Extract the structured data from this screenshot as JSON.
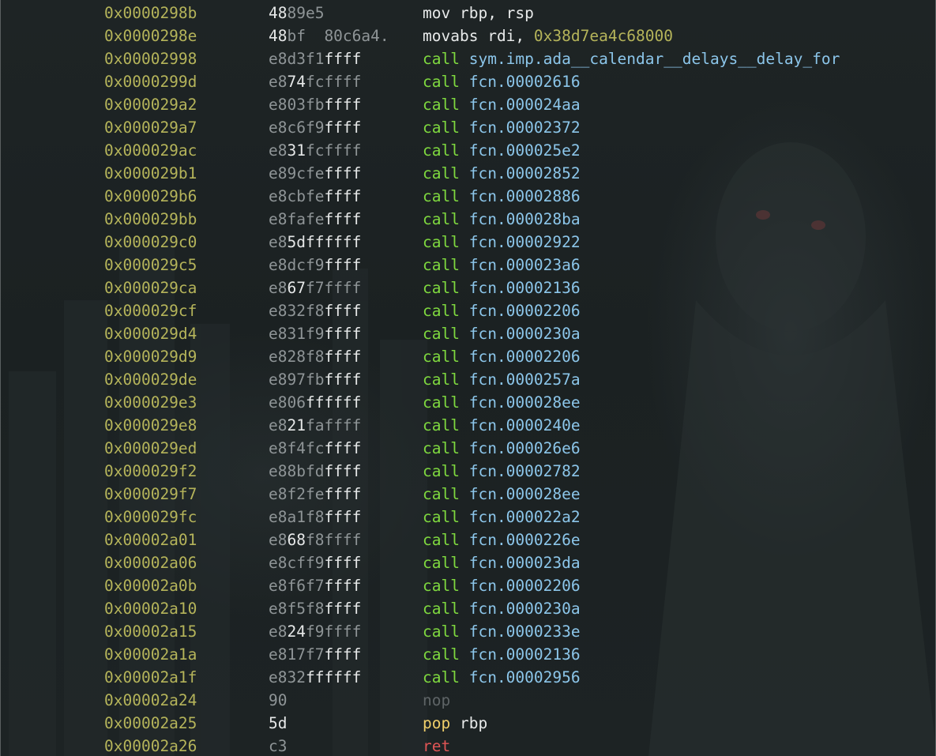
{
  "disassembly": {
    "rows": [
      {
        "address": "0x0000298b",
        "bytes_dim": "",
        "bytes_bright": "48",
        "bytes_tail": "89e5",
        "mnemonic": "mov",
        "mnemonic_class": "plain",
        "operand": "rbp, rsp",
        "operand_class": "plain"
      },
      {
        "address": "0x0000298e",
        "bytes_dim": "",
        "bytes_bright": "48",
        "bytes_tail": "bf  80c6a4.",
        "mnemonic": "movabs",
        "mnemonic_class": "plain",
        "operand": "rdi, ",
        "operand_class": "plain",
        "operand_imm": "0x38d7ea4c68000"
      },
      {
        "address": "0x00002998",
        "bytes_dim": "e8d3f1",
        "bytes_bright": "ffff",
        "bytes_tail": "",
        "mnemonic": "call",
        "mnemonic_class": "call",
        "operand": "sym.imp.ada__calendar__delays__delay_for",
        "operand_class": "target"
      },
      {
        "address": "0x0000299d",
        "bytes_dim": "e8",
        "bytes_bright": "74",
        "bytes_tail": "fcffff",
        "mnemonic": "call",
        "mnemonic_class": "call",
        "operand": "fcn.00002616",
        "operand_class": "target"
      },
      {
        "address": "0x000029a2",
        "bytes_dim": "e803fb",
        "bytes_bright": "ffff",
        "bytes_tail": "",
        "mnemonic": "call",
        "mnemonic_class": "call",
        "operand": "fcn.000024aa",
        "operand_class": "target"
      },
      {
        "address": "0x000029a7",
        "bytes_dim": "e8c6f9",
        "bytes_bright": "ffff",
        "bytes_tail": "",
        "mnemonic": "call",
        "mnemonic_class": "call",
        "operand": "fcn.00002372",
        "operand_class": "target"
      },
      {
        "address": "0x000029ac",
        "bytes_dim": "e8",
        "bytes_bright": "31",
        "bytes_tail": "fcffff",
        "mnemonic": "call",
        "mnemonic_class": "call",
        "operand": "fcn.000025e2",
        "operand_class": "target"
      },
      {
        "address": "0x000029b1",
        "bytes_dim": "e89cfe",
        "bytes_bright": "ffff",
        "bytes_tail": "",
        "mnemonic": "call",
        "mnemonic_class": "call",
        "operand": "fcn.00002852",
        "operand_class": "target"
      },
      {
        "address": "0x000029b6",
        "bytes_dim": "e8cbfe",
        "bytes_bright": "ffff",
        "bytes_tail": "",
        "mnemonic": "call",
        "mnemonic_class": "call",
        "operand": "fcn.00002886",
        "operand_class": "target"
      },
      {
        "address": "0x000029bb",
        "bytes_dim": "e8fafe",
        "bytes_bright": "ffff",
        "bytes_tail": "",
        "mnemonic": "call",
        "mnemonic_class": "call",
        "operand": "fcn.000028ba",
        "operand_class": "target"
      },
      {
        "address": "0x000029c0",
        "bytes_dim": "e8",
        "bytes_bright": "5dffffff",
        "bytes_tail": "",
        "mnemonic": "call",
        "mnemonic_class": "call",
        "operand": "fcn.00002922",
        "operand_class": "target"
      },
      {
        "address": "0x000029c5",
        "bytes_dim": "e8dcf9",
        "bytes_bright": "ffff",
        "bytes_tail": "",
        "mnemonic": "call",
        "mnemonic_class": "call",
        "operand": "fcn.000023a6",
        "operand_class": "target"
      },
      {
        "address": "0x000029ca",
        "bytes_dim": "e8",
        "bytes_bright": "67",
        "bytes_tail": "f7ffff",
        "mnemonic": "call",
        "mnemonic_class": "call",
        "operand": "fcn.00002136",
        "operand_class": "target"
      },
      {
        "address": "0x000029cf",
        "bytes_dim": "e832f8",
        "bytes_bright": "ffff",
        "bytes_tail": "",
        "mnemonic": "call",
        "mnemonic_class": "call",
        "operand": "fcn.00002206",
        "operand_class": "target"
      },
      {
        "address": "0x000029d4",
        "bytes_dim": "e831f9",
        "bytes_bright": "ffff",
        "bytes_tail": "",
        "mnemonic": "call",
        "mnemonic_class": "call",
        "operand": "fcn.0000230a",
        "operand_class": "target"
      },
      {
        "address": "0x000029d9",
        "bytes_dim": "e828f8",
        "bytes_bright": "ffff",
        "bytes_tail": "",
        "mnemonic": "call",
        "mnemonic_class": "call",
        "operand": "fcn.00002206",
        "operand_class": "target"
      },
      {
        "address": "0x000029de",
        "bytes_dim": "e897fb",
        "bytes_bright": "ffff",
        "bytes_tail": "",
        "mnemonic": "call",
        "mnemonic_class": "call",
        "operand": "fcn.0000257a",
        "operand_class": "target"
      },
      {
        "address": "0x000029e3",
        "bytes_dim": "e806",
        "bytes_bright": "ffffff",
        "bytes_tail": "",
        "mnemonic": "call",
        "mnemonic_class": "call",
        "operand": "fcn.000028ee",
        "operand_class": "target"
      },
      {
        "address": "0x000029e8",
        "bytes_dim": "e8",
        "bytes_bright": "21",
        "bytes_tail": "faffff",
        "mnemonic": "call",
        "mnemonic_class": "call",
        "operand": "fcn.0000240e",
        "operand_class": "target"
      },
      {
        "address": "0x000029ed",
        "bytes_dim": "e8f4fc",
        "bytes_bright": "ffff",
        "bytes_tail": "",
        "mnemonic": "call",
        "mnemonic_class": "call",
        "operand": "fcn.000026e6",
        "operand_class": "target"
      },
      {
        "address": "0x000029f2",
        "bytes_dim": "e88bfd",
        "bytes_bright": "ffff",
        "bytes_tail": "",
        "mnemonic": "call",
        "mnemonic_class": "call",
        "operand": "fcn.00002782",
        "operand_class": "target"
      },
      {
        "address": "0x000029f7",
        "bytes_dim": "e8f2fe",
        "bytes_bright": "ffff",
        "bytes_tail": "",
        "mnemonic": "call",
        "mnemonic_class": "call",
        "operand": "fcn.000028ee",
        "operand_class": "target"
      },
      {
        "address": "0x000029fc",
        "bytes_dim": "e8a1f8",
        "bytes_bright": "ffff",
        "bytes_tail": "",
        "mnemonic": "call",
        "mnemonic_class": "call",
        "operand": "fcn.000022a2",
        "operand_class": "target"
      },
      {
        "address": "0x00002a01",
        "bytes_dim": "e8",
        "bytes_bright": "68",
        "bytes_tail": "f8ffff",
        "mnemonic": "call",
        "mnemonic_class": "call",
        "operand": "fcn.0000226e",
        "operand_class": "target"
      },
      {
        "address": "0x00002a06",
        "bytes_dim": "e8cff9",
        "bytes_bright": "ffff",
        "bytes_tail": "",
        "mnemonic": "call",
        "mnemonic_class": "call",
        "operand": "fcn.000023da",
        "operand_class": "target"
      },
      {
        "address": "0x00002a0b",
        "bytes_dim": "e8f6f7",
        "bytes_bright": "ffff",
        "bytes_tail": "",
        "mnemonic": "call",
        "mnemonic_class": "call",
        "operand": "fcn.00002206",
        "operand_class": "target"
      },
      {
        "address": "0x00002a10",
        "bytes_dim": "e8f5f8",
        "bytes_bright": "ffff",
        "bytes_tail": "",
        "mnemonic": "call",
        "mnemonic_class": "call",
        "operand": "fcn.0000230a",
        "operand_class": "target"
      },
      {
        "address": "0x00002a15",
        "bytes_dim": "e8",
        "bytes_bright": "24",
        "bytes_tail": "f9ffff",
        "mnemonic": "call",
        "mnemonic_class": "call",
        "operand": "fcn.0000233e",
        "operand_class": "target"
      },
      {
        "address": "0x00002a1a",
        "bytes_dim": "e817f7",
        "bytes_bright": "ffff",
        "bytes_tail": "",
        "mnemonic": "call",
        "mnemonic_class": "call",
        "operand": "fcn.00002136",
        "operand_class": "target"
      },
      {
        "address": "0x00002a1f",
        "bytes_dim": "e832",
        "bytes_bright": "ffffff",
        "bytes_tail": "",
        "mnemonic": "call",
        "mnemonic_class": "call",
        "operand": "fcn.00002956",
        "operand_class": "target"
      },
      {
        "address": "0x00002a24",
        "bytes_dim": "90",
        "bytes_bright": "",
        "bytes_tail": "",
        "mnemonic": "nop",
        "mnemonic_class": "nop",
        "operand": "",
        "operand_class": "plain"
      },
      {
        "address": "0x00002a25",
        "bytes_dim": "",
        "bytes_bright": "5d",
        "bytes_tail": "",
        "mnemonic": "pop",
        "mnemonic_class": "pop",
        "operand": "rbp",
        "operand_class": "plain"
      },
      {
        "address": "0x00002a26",
        "bytes_dim": "c3",
        "bytes_bright": "",
        "bytes_tail": "",
        "mnemonic": "ret",
        "mnemonic_class": "ret",
        "operand": "",
        "operand_class": "plain"
      }
    ]
  },
  "colors": {
    "address": "#b5b45a",
    "call": "#7fd93f",
    "target": "#8cc6ea",
    "pop": "#f0cf6a",
    "ret": "#e05555",
    "nop": "#5e6466",
    "background": "#1a1f20"
  }
}
